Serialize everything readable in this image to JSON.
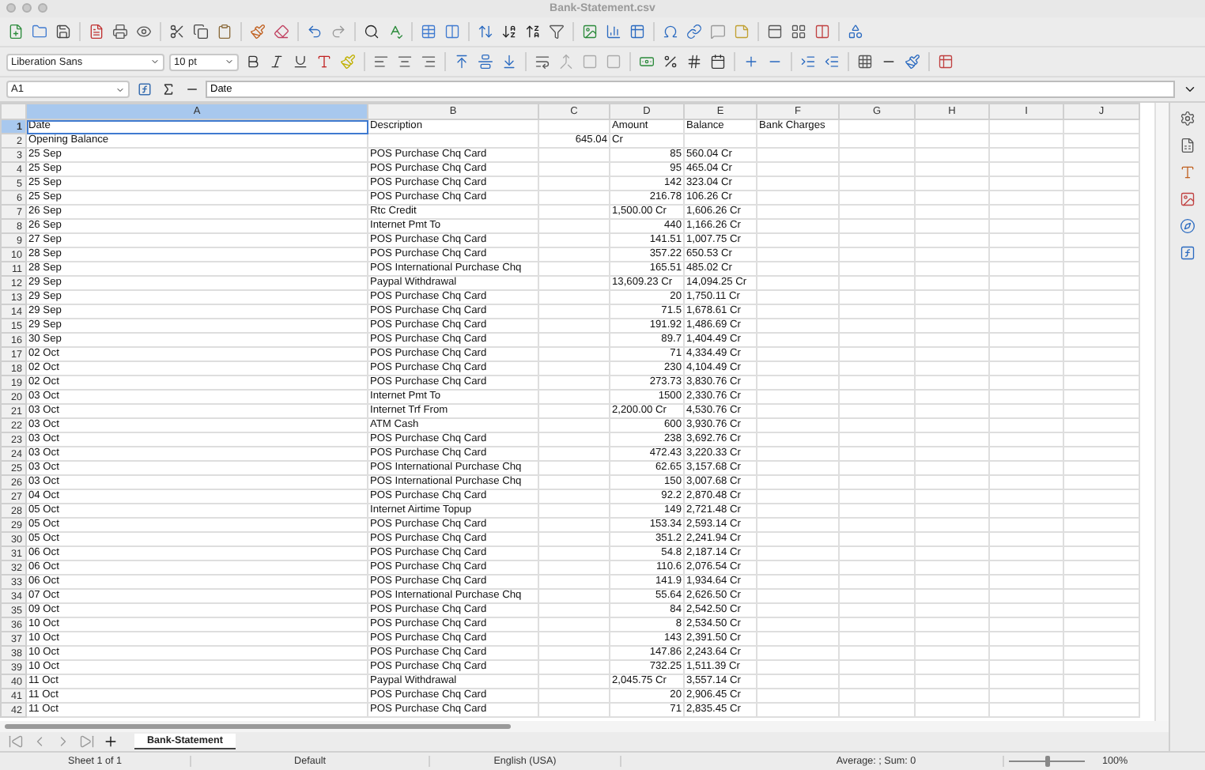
{
  "window": {
    "title": "Bank-Statement.csv"
  },
  "toolbar": {
    "font_name": "Liberation Sans",
    "font_size": "10 pt"
  },
  "formula_bar": {
    "name_box": "A1",
    "formula": "Date"
  },
  "columns": [
    {
      "label": "A",
      "selected": true
    },
    {
      "label": "B",
      "selected": false
    },
    {
      "label": "C",
      "selected": false
    },
    {
      "label": "D",
      "selected": false
    },
    {
      "label": "E",
      "selected": false
    },
    {
      "label": "F",
      "selected": false
    },
    {
      "label": "G",
      "selected": false
    },
    {
      "label": "H",
      "selected": false
    },
    {
      "label": "I",
      "selected": false
    },
    {
      "label": "J",
      "selected": false
    }
  ],
  "rows": [
    {
      "number": "1",
      "selected": true,
      "date": "Date",
      "description": "Description",
      "amount": {
        "text": "Amount",
        "kind": "text"
      },
      "balance": "Balance",
      "column_f": "Bank Charges"
    },
    {
      "number": "2",
      "selected": false,
      "date": "Opening Balance",
      "column_c": "645.04",
      "amount": {
        "text": "Cr",
        "kind": "text"
      }
    },
    {
      "number": "3",
      "selected": false,
      "date": "25 Sep",
      "description": "POS Purchase Chq Card",
      "amount": {
        "text": "85",
        "kind": "number"
      },
      "balance": "560.04 Cr"
    },
    {
      "number": "4",
      "selected": false,
      "date": "25 Sep",
      "description": "POS Purchase Chq Card",
      "amount": {
        "text": "95",
        "kind": "number"
      },
      "balance": "465.04 Cr"
    },
    {
      "number": "5",
      "selected": false,
      "date": "25 Sep",
      "description": "POS Purchase Chq Card",
      "amount": {
        "text": "142",
        "kind": "number"
      },
      "balance": "323.04 Cr"
    },
    {
      "number": "6",
      "selected": false,
      "date": "25 Sep",
      "description": "POS Purchase Chq Card",
      "amount": {
        "text": "216.78",
        "kind": "number"
      },
      "balance": "106.26 Cr"
    },
    {
      "number": "7",
      "selected": false,
      "date": "26 Sep",
      "description": "Rtc Credit",
      "amount": {
        "text": "1,500.00 Cr",
        "kind": "text"
      },
      "balance": "1,606.26 Cr"
    },
    {
      "number": "8",
      "selected": false,
      "date": "26 Sep",
      "description": "Internet Pmt To",
      "amount": {
        "text": "440",
        "kind": "number"
      },
      "balance": "1,166.26 Cr"
    },
    {
      "number": "9",
      "selected": false,
      "date": "27 Sep",
      "description": "POS Purchase Chq Card",
      "amount": {
        "text": "141.51",
        "kind": "number"
      },
      "balance": "1,007.75 Cr"
    },
    {
      "number": "10",
      "selected": false,
      "date": "28 Sep",
      "description": "POS Purchase Chq Card",
      "amount": {
        "text": "357.22",
        "kind": "number"
      },
      "balance": "650.53 Cr"
    },
    {
      "number": "11",
      "selected": false,
      "date": "28 Sep",
      "description": "POS International Purchase Chq",
      "amount": {
        "text": "165.51",
        "kind": "number"
      },
      "balance": "485.02 Cr"
    },
    {
      "number": "12",
      "selected": false,
      "date": "29 Sep",
      "description": "Paypal Withdrawal",
      "amount": {
        "text": "13,609.23 Cr",
        "kind": "text"
      },
      "balance": "14,094.25 Cr"
    },
    {
      "number": "13",
      "selected": false,
      "date": "29 Sep",
      "description": "POS Purchase Chq Card",
      "amount": {
        "text": "20",
        "kind": "number"
      },
      "balance": "1,750.11 Cr"
    },
    {
      "number": "14",
      "selected": false,
      "date": "29 Sep",
      "description": "POS Purchase Chq Card",
      "amount": {
        "text": "71.5",
        "kind": "number"
      },
      "balance": "1,678.61 Cr"
    },
    {
      "number": "15",
      "selected": false,
      "date": "29 Sep",
      "description": "POS Purchase Chq Card",
      "amount": {
        "text": "191.92",
        "kind": "number"
      },
      "balance": "1,486.69 Cr"
    },
    {
      "number": "16",
      "selected": false,
      "date": "30 Sep",
      "description": "POS Purchase Chq Card",
      "amount": {
        "text": "89.7",
        "kind": "number"
      },
      "balance": "1,404.49 Cr"
    },
    {
      "number": "17",
      "selected": false,
      "date": "02 Oct",
      "description": "POS Purchase Chq Card",
      "amount": {
        "text": "71",
        "kind": "number"
      },
      "balance": "4,334.49 Cr"
    },
    {
      "number": "18",
      "selected": false,
      "date": "02 Oct",
      "description": "POS Purchase Chq Card",
      "amount": {
        "text": "230",
        "kind": "number"
      },
      "balance": "4,104.49 Cr"
    },
    {
      "number": "19",
      "selected": false,
      "date": "02 Oct",
      "description": "POS Purchase Chq Card",
      "amount": {
        "text": "273.73",
        "kind": "number"
      },
      "balance": "3,830.76 Cr"
    },
    {
      "number": "20",
      "selected": false,
      "date": "03 Oct",
      "description": "Internet Pmt To",
      "amount": {
        "text": "1500",
        "kind": "number"
      },
      "balance": "2,330.76 Cr"
    },
    {
      "number": "21",
      "selected": false,
      "date": "03 Oct",
      "description": "Internet Trf From",
      "amount": {
        "text": "2,200.00 Cr",
        "kind": "text"
      },
      "balance": "4,530.76 Cr"
    },
    {
      "number": "22",
      "selected": false,
      "date": "03 Oct",
      "description": "ATM Cash",
      "amount": {
        "text": "600",
        "kind": "number"
      },
      "balance": "3,930.76 Cr"
    },
    {
      "number": "23",
      "selected": false,
      "date": "03 Oct",
      "description": "POS Purchase Chq Card",
      "amount": {
        "text": "238",
        "kind": "number"
      },
      "balance": "3,692.76 Cr"
    },
    {
      "number": "24",
      "selected": false,
      "date": "03 Oct",
      "description": "POS Purchase Chq Card",
      "amount": {
        "text": "472.43",
        "kind": "number"
      },
      "balance": "3,220.33 Cr"
    },
    {
      "number": "25",
      "selected": false,
      "date": "03 Oct",
      "description": "POS International Purchase Chq",
      "amount": {
        "text": "62.65",
        "kind": "number"
      },
      "balance": "3,157.68 Cr"
    },
    {
      "number": "26",
      "selected": false,
      "date": "03 Oct",
      "description": "POS International Purchase Chq",
      "amount": {
        "text": "150",
        "kind": "number"
      },
      "balance": "3,007.68 Cr"
    },
    {
      "number": "27",
      "selected": false,
      "date": "04 Oct",
      "description": "POS Purchase Chq Card",
      "amount": {
        "text": "92.2",
        "kind": "number"
      },
      "balance": "2,870.48 Cr"
    },
    {
      "number": "28",
      "selected": false,
      "date": "05 Oct",
      "description": "Internet Airtime Topup",
      "amount": {
        "text": "149",
        "kind": "number"
      },
      "balance": "2,721.48 Cr"
    },
    {
      "number": "29",
      "selected": false,
      "date": "05 Oct",
      "description": "POS Purchase Chq Card",
      "amount": {
        "text": "153.34",
        "kind": "number"
      },
      "balance": "2,593.14 Cr"
    },
    {
      "number": "30",
      "selected": false,
      "date": "05 Oct",
      "description": "POS Purchase Chq Card",
      "amount": {
        "text": "351.2",
        "kind": "number"
      },
      "balance": "2,241.94 Cr"
    },
    {
      "number": "31",
      "selected": false,
      "date": "06 Oct",
      "description": "POS Purchase Chq Card",
      "amount": {
        "text": "54.8",
        "kind": "number"
      },
      "balance": "2,187.14 Cr"
    },
    {
      "number": "32",
      "selected": false,
      "date": "06 Oct",
      "description": "POS Purchase Chq Card",
      "amount": {
        "text": "110.6",
        "kind": "number"
      },
      "balance": "2,076.54 Cr"
    },
    {
      "number": "33",
      "selected": false,
      "date": "06 Oct",
      "description": "POS Purchase Chq Card",
      "amount": {
        "text": "141.9",
        "kind": "number"
      },
      "balance": "1,934.64 Cr"
    },
    {
      "number": "34",
      "selected": false,
      "date": "07 Oct",
      "description": "POS International Purchase Chq",
      "amount": {
        "text": "55.64",
        "kind": "number"
      },
      "balance": "2,626.50 Cr"
    },
    {
      "number": "35",
      "selected": false,
      "date": "09 Oct",
      "description": "POS Purchase Chq Card",
      "amount": {
        "text": "84",
        "kind": "number"
      },
      "balance": "2,542.50 Cr"
    },
    {
      "number": "36",
      "selected": false,
      "date": "10 Oct",
      "description": "POS Purchase Chq Card",
      "amount": {
        "text": "8",
        "kind": "number"
      },
      "balance": "2,534.50 Cr"
    },
    {
      "number": "37",
      "selected": false,
      "date": "10 Oct",
      "description": "POS Purchase Chq Card",
      "amount": {
        "text": "143",
        "kind": "number"
      },
      "balance": "2,391.50 Cr"
    },
    {
      "number": "38",
      "selected": false,
      "date": "10 Oct",
      "description": "POS Purchase Chq Card",
      "amount": {
        "text": "147.86",
        "kind": "number"
      },
      "balance": "2,243.64 Cr"
    },
    {
      "number": "39",
      "selected": false,
      "date": "10 Oct",
      "description": "POS Purchase Chq Card",
      "amount": {
        "text": "732.25",
        "kind": "number"
      },
      "balance": "1,511.39 Cr"
    },
    {
      "number": "40",
      "selected": false,
      "date": "11 Oct",
      "description": "Paypal Withdrawal",
      "amount": {
        "text": "2,045.75 Cr",
        "kind": "text"
      },
      "balance": "3,557.14 Cr"
    },
    {
      "number": "41",
      "selected": false,
      "date": "11 Oct",
      "description": "POS Purchase Chq Card",
      "amount": {
        "text": "20",
        "kind": "number"
      },
      "balance": "2,906.45 Cr"
    },
    {
      "number": "42",
      "selected": false,
      "date": "11 Oct",
      "description": "POS Purchase Chq Card",
      "amount": {
        "text": "71",
        "kind": "number"
      },
      "balance": "2,835.45 Cr"
    }
  ],
  "sheet_tabs": [
    {
      "label": "Bank-Statement",
      "selected": true
    }
  ],
  "status_bar": {
    "sheet": "Sheet 1 of 1",
    "page_style": "Default",
    "language": "English (USA)",
    "summary": "Average: ; Sum: 0",
    "zoom": "100%",
    "zoom_slider": {
      "level": 0.5
    }
  }
}
